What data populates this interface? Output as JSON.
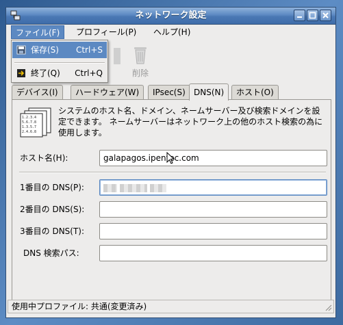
{
  "window": {
    "title": "ネットワーク設定"
  },
  "menubar": {
    "file": "ファイル(F)",
    "profile": "プロフィール(P)",
    "help": "ヘルプ(H)"
  },
  "file_menu": {
    "save": {
      "label": "保存(S)",
      "accel": "Ctrl+S"
    },
    "quit": {
      "label": "終了(Q)",
      "accel": "Ctrl+Q"
    }
  },
  "toolbar": {
    "delete_label": "削除"
  },
  "tabs": [
    "デバイス(I)",
    "ハードウェア(W)",
    "IPsec(S)",
    "DNS(N)",
    "ホスト(O)"
  ],
  "active_tab": "DNS(N)",
  "dns": {
    "description": "システムのホスト名、ドメイン、ネームサーバー及び検索ドメインを設定できます。 ネームサーバーはネットワーク上の他のホスト検索の為に使用します。",
    "hostname_label": "ホスト名(H):",
    "hostname_value": "galapagos.ipentec.com",
    "dns1_label": "1番目の DNS(P):",
    "dns1_value": "",
    "dns2_label": "2番目の DNS(S):",
    "dns2_value": "",
    "dns3_label": "3番目の DNS(T):",
    "dns3_value": "",
    "search_label": "DNS 検索パス:",
    "search_value": ""
  },
  "status": {
    "text": "使用中プロファイル: 共通(変更済み)"
  }
}
